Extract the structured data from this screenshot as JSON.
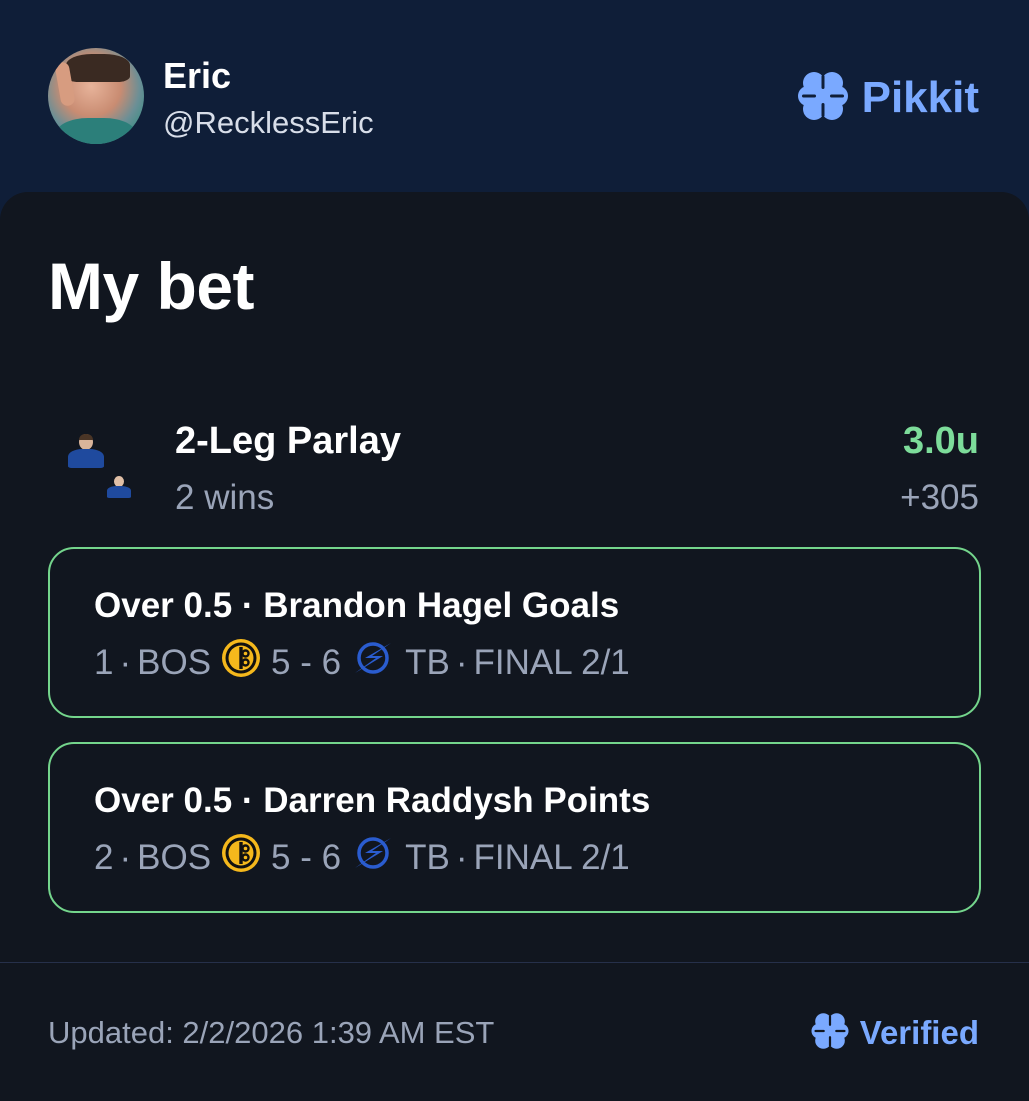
{
  "user": {
    "name": "Eric",
    "handle": "@RecklessEric"
  },
  "brand": {
    "name": "Pikkit",
    "icon": "clover-icon",
    "color": "#7aa9ff"
  },
  "card": {
    "title": "My bet"
  },
  "parlay": {
    "title": "2-Leg Parlay",
    "result": "2 wins",
    "units": "3.0u",
    "odds": "+305",
    "units_color": "#7ddc9a"
  },
  "legs": [
    {
      "title": "Over 0.5 · Brandon Hagel Goals",
      "result_value": "1",
      "away_team": "BOS",
      "score": "5 - 6",
      "home_team": "TB",
      "status": "FINAL 2/1"
    },
    {
      "title": "Over 0.5 · Darren Raddysh Points",
      "result_value": "2",
      "away_team": "BOS",
      "score": "5 - 6",
      "home_team": "TB",
      "status": "FINAL 2/1"
    }
  ],
  "footer": {
    "updated": "Updated: 2/2/2026 1:39 AM EST",
    "verified": "Verified"
  },
  "colors": {
    "header_bg": "#0f1e38",
    "card_bg": "#11161f",
    "win_border": "#74d58c",
    "muted_text": "#9aa4b8"
  }
}
